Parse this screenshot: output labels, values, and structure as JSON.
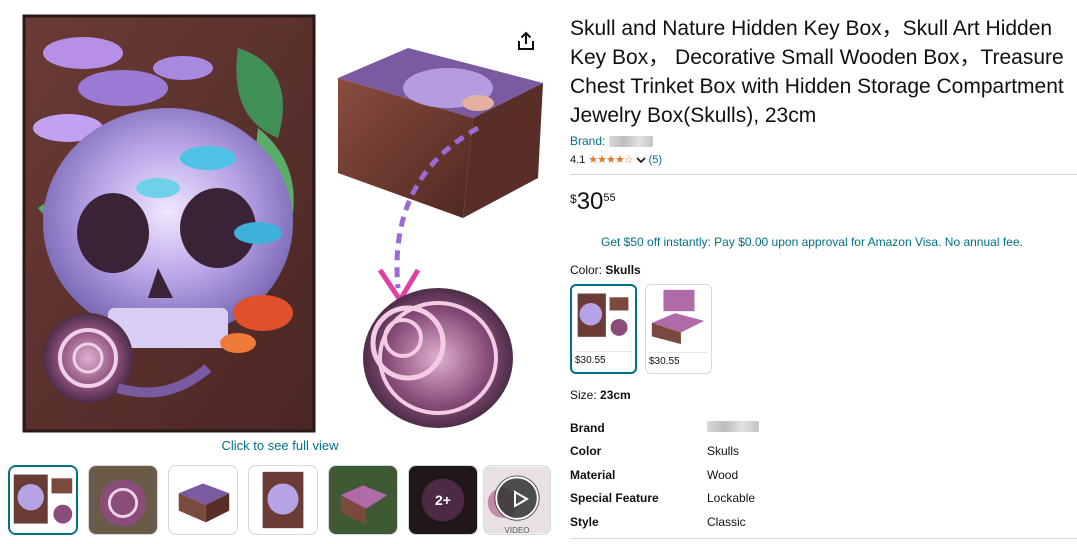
{
  "product": {
    "title": "Skull and Nature Hidden Key Box，Skull Art Hidden Key Box， Decorative Small Wooden Box，Treasure Chest Trinket Box with Hidden Storage Compartment Jewelry Box(Skulls), 23cm",
    "brand_label": "Brand:",
    "rating_value": "4.1",
    "stars": "★★★★☆",
    "rating_count": "(5)",
    "price_symbol": "$",
    "price_whole": "30",
    "price_fraction": "55",
    "promo": "Get $50 off instantly: Pay $0.00 upon approval for Amazon Visa. No annual fee.",
    "color_label": "Color:",
    "color_value": "Skulls",
    "size_label": "Size:",
    "size_value": "23cm"
  },
  "gallery": {
    "full_view": "Click to see full view",
    "more_count": "2+",
    "video_label": "VIDEO"
  },
  "swatches": [
    {
      "price": "$30.55"
    },
    {
      "price": "$30.55"
    }
  ],
  "specs": [
    {
      "key": "Brand",
      "value": ""
    },
    {
      "key": "Color",
      "value": "Skulls"
    },
    {
      "key": "Material",
      "value": "Wood"
    },
    {
      "key": "Special Feature",
      "value": "Lockable"
    },
    {
      "key": "Style",
      "value": "Classic"
    }
  ],
  "colors": {
    "link": "#007185",
    "star": "#de7921",
    "selected_border": "#007185"
  },
  "icons": [
    "share-icon",
    "chevron-down-icon",
    "play-icon"
  ]
}
